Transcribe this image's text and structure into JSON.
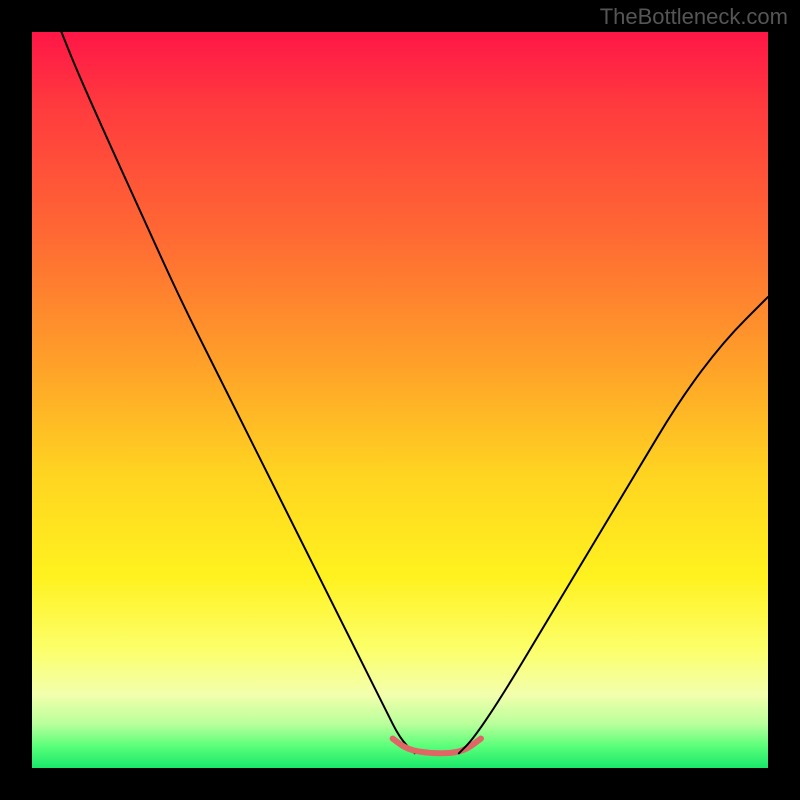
{
  "watermark": "TheBottleneck.com",
  "chart_data": {
    "type": "line",
    "title": "",
    "xlabel": "",
    "ylabel": "",
    "xlim": [
      0,
      100
    ],
    "ylim": [
      0,
      100
    ],
    "grid": false,
    "legend": false,
    "gradient_stops": [
      {
        "pos": 0,
        "color": "#ff1647"
      },
      {
        "pos": 10,
        "color": "#ff3a3e"
      },
      {
        "pos": 28,
        "color": "#ff6a33"
      },
      {
        "pos": 45,
        "color": "#ffa029"
      },
      {
        "pos": 60,
        "color": "#ffd421"
      },
      {
        "pos": 74,
        "color": "#fff21f"
      },
      {
        "pos": 84,
        "color": "#fcff6b"
      },
      {
        "pos": 90,
        "color": "#f3ffad"
      },
      {
        "pos": 94,
        "color": "#b9ff9b"
      },
      {
        "pos": 97,
        "color": "#5bff7a"
      },
      {
        "pos": 100,
        "color": "#18e86a"
      }
    ],
    "series": [
      {
        "name": "left-curve",
        "x": [
          4,
          6,
          10,
          15,
          20,
          25,
          30,
          35,
          40,
          45,
          48,
          50,
          52
        ],
        "y": [
          100,
          95,
          86,
          75,
          64,
          54,
          44,
          34,
          24,
          14,
          8,
          4,
          2
        ],
        "stroke": "#000000",
        "stroke_width": 2
      },
      {
        "name": "trough-band",
        "x": [
          49,
          51,
          54,
          57,
          59,
          61
        ],
        "y": [
          4,
          2.5,
          2,
          2,
          2.5,
          4
        ],
        "stroke": "#e06666",
        "stroke_width": 6
      },
      {
        "name": "right-curve",
        "x": [
          58,
          60,
          64,
          70,
          76,
          82,
          88,
          94,
          100
        ],
        "y": [
          2,
          4,
          10,
          20,
          30,
          40,
          50,
          58,
          64
        ],
        "stroke": "#000000",
        "stroke_width": 2
      }
    ]
  }
}
